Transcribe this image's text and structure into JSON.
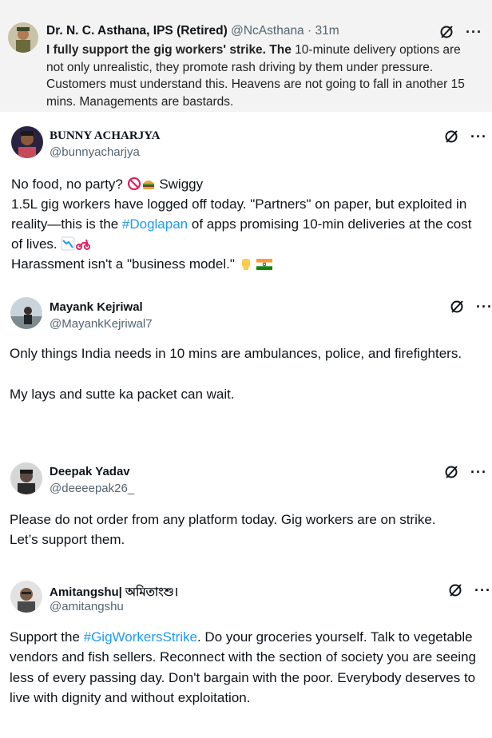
{
  "tweets": [
    {
      "name": "Dr. N. C. Asthana, IPS (Retired)",
      "handle": "@NcAsthana",
      "time_sep": " · ",
      "time": "31m",
      "text_bold": "I fully support the gig workers' strike. The",
      "text_rest": " 10-minute delivery options are not only unrealistic, they promote rash driving by them under pressure. Customers must understand this. Heavens are not going to fall in another 15 mins. Managements are bastards."
    },
    {
      "name": "BUNNY ACHARJYA",
      "handle": "@bunnyacharjya",
      "line1_a": "No food, no party? ",
      "line1_b": " Swiggy",
      "line2": "1.5L gig workers have logged off today. \"Partners\" on paper, but exploited in reality—this is the ",
      "hashtag": "#Doglapan",
      "line2_rest": " of apps promising 10-min deliveries at the cost of lives. ",
      "line3": "Harassment isn't a \"business model.\" "
    },
    {
      "name": "Mayank Kejriwal",
      "handle": "@MayankKejriwal7",
      "text": "Only things India needs in 10 mins are ambulances, police, and firefighters.\n\nMy lays and sutte ka packet can wait."
    },
    {
      "name": "Deepak Yadav",
      "handle": "@deeeepak26_",
      "text": "Please do not order from any platform today. Gig workers are on strike.\nLet’s support them."
    },
    {
      "name": "Amitangshu| অমিতাংশু।",
      "handle": "@amitangshu",
      "text_a": "Support the ",
      "hashtag": "#GigWorkersStrike",
      "text_b": ". Do your groceries yourself. Talk to vegetable vendors and fish sellers. Reconnect with the section of society you are seeing less of every passing day. Don't bargain with the poor. Everybody deserves to live with dignity and without exploitation."
    }
  ],
  "icons": {
    "grok": "grok-icon",
    "more": "more-icon",
    "no_entry": "no-entry-emoji",
    "burger": "burger-emoji",
    "chart_down": "chart-decreasing-emoji",
    "scooter": "scooter-emoji",
    "fist": "raised-fist-emoji",
    "flag": "india-flag-emoji"
  },
  "more_label": "···",
  "colors": {
    "link": "#1d9bf0",
    "secondary": "#536471",
    "first_bg": "#f3f3f3"
  }
}
